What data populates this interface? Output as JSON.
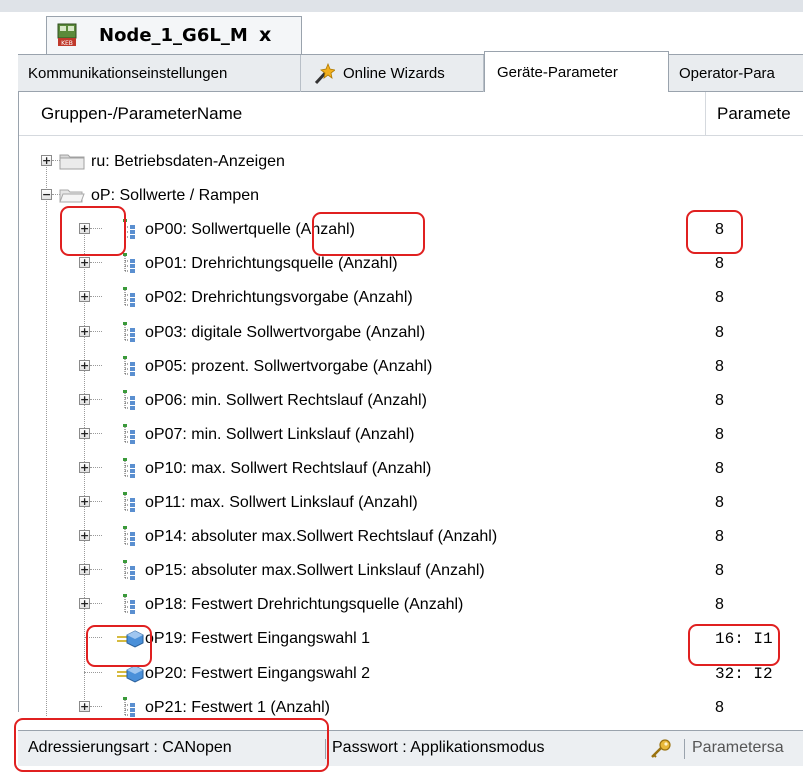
{
  "document_tab": {
    "title": "Node_1_G6L_M",
    "close": "x",
    "icon": "keb-device-icon"
  },
  "tabs": [
    {
      "label": "Kommunikationseinstellungen",
      "active": false
    },
    {
      "label": "Online Wizards",
      "active": false,
      "icon": "wand-icon"
    },
    {
      "label": "Geräte-Parameter",
      "active": true
    },
    {
      "label": "Operator-Para",
      "active": false
    }
  ],
  "columns": {
    "name": "Gruppen-/ParameterName",
    "value": "Paramete"
  },
  "tree": [
    {
      "label": "ru: Betriebsdaten-Anzeigen",
      "type": "group",
      "expander": "+",
      "value": ""
    },
    {
      "label": "oP: Sollwerte / Rampen",
      "type": "group",
      "expander": "−",
      "value": ""
    },
    {
      "label": "oP00: Sollwertquelle (Anzahl)",
      "type": "param-array",
      "expander": "+",
      "value": "8"
    },
    {
      "label": "oP01: Drehrichtungsquelle (Anzahl)",
      "type": "param-array",
      "expander": "+",
      "value": "8"
    },
    {
      "label": "oP02: Drehrichtungsvorgabe (Anzahl)",
      "type": "param-array",
      "expander": "+",
      "value": "8"
    },
    {
      "label": "oP03: digitale Sollwertvorgabe (Anzahl)",
      "type": "param-array",
      "expander": "+",
      "value": "8"
    },
    {
      "label": "oP05: prozent. Sollwertvorgabe (Anzahl)",
      "type": "param-array",
      "expander": "+",
      "value": "8"
    },
    {
      "label": "oP06: min. Sollwert Rechtslauf (Anzahl)",
      "type": "param-array",
      "expander": "+",
      "value": "8"
    },
    {
      "label": "oP07: min. Sollwert Linkslauf (Anzahl)",
      "type": "param-array",
      "expander": "+",
      "value": "8"
    },
    {
      "label": "oP10: max. Sollwert Rechtslauf (Anzahl)",
      "type": "param-array",
      "expander": "+",
      "value": "8"
    },
    {
      "label": "oP11: max. Sollwert Linkslauf (Anzahl)",
      "type": "param-array",
      "expander": "+",
      "value": "8"
    },
    {
      "label": "oP14: absoluter max.Sollwert Rechtslauf (Anzahl)",
      "type": "param-array",
      "expander": "+",
      "value": "8"
    },
    {
      "label": "oP15: absoluter max.Sollwert Linkslauf (Anzahl)",
      "type": "param-array",
      "expander": "+",
      "value": "8"
    },
    {
      "label": "oP18: Festwert Drehrichtungsquelle (Anzahl)",
      "type": "param-array",
      "expander": "+",
      "value": "8"
    },
    {
      "label": "oP19: Festwert Eingangswahl 1",
      "type": "param-single",
      "expander": "",
      "value": "16: I1"
    },
    {
      "label": "oP20: Festwert Eingangswahl 2",
      "type": "param-single",
      "expander": "",
      "value": "32: I2"
    },
    {
      "label": "oP21: Festwert 1 (Anzahl)",
      "type": "param-array",
      "expander": "+",
      "value": "8"
    }
  ],
  "status": {
    "addressing": "Adressierungsart  : CANopen",
    "password": "Passwort  : Applikationsmodus",
    "params": "Parametersa",
    "key_icon": "key-icon"
  },
  "colors": {
    "highlight": "#e02020",
    "border": "#9aa3ad",
    "tab_bg": "#e9ecef"
  }
}
